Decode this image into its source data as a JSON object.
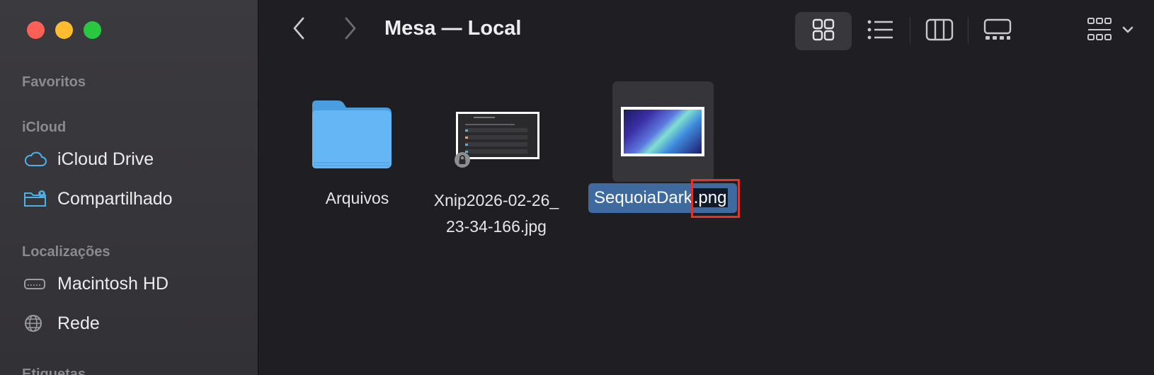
{
  "window": {
    "title": "Mesa — Local"
  },
  "sidebar": {
    "sections": {
      "favorites": "Favoritos",
      "icloud": "iCloud",
      "locations": "Localizações",
      "tags": "Etiquetas"
    },
    "items": [
      {
        "label": "iCloud Drive",
        "icon": "cloud-icon"
      },
      {
        "label": "Compartilhado",
        "icon": "shared-folder-icon"
      },
      {
        "label": "Macintosh HD",
        "icon": "hard-drive-icon"
      },
      {
        "label": "Rede",
        "icon": "globe-icon"
      }
    ]
  },
  "toolbar": {
    "back_icon": "chevron-left-icon",
    "forward_icon": "chevron-right-icon",
    "view_modes": [
      "icon-view-icon",
      "list-view-icon",
      "column-view-icon",
      "gallery-view-icon"
    ],
    "active_view": "icon-view-icon",
    "group_icon": "group-by-icon"
  },
  "files": [
    {
      "name": "Arquivos",
      "type": "folder"
    },
    {
      "name_line1": "Xnip2026-02-26_",
      "name_line2": "23-34-166.jpg",
      "type": "image",
      "locked": true
    },
    {
      "name_base": "SequoiaDark",
      "name_ext": ".png",
      "type": "image",
      "selected": true,
      "renaming": true
    }
  ],
  "colors": {
    "accent": "#3e6a9f",
    "folder": "#5aaef0",
    "highlight": "#e2322a",
    "traffic_close": "#fe5f57",
    "traffic_min": "#febc2e",
    "traffic_max": "#28c840"
  }
}
